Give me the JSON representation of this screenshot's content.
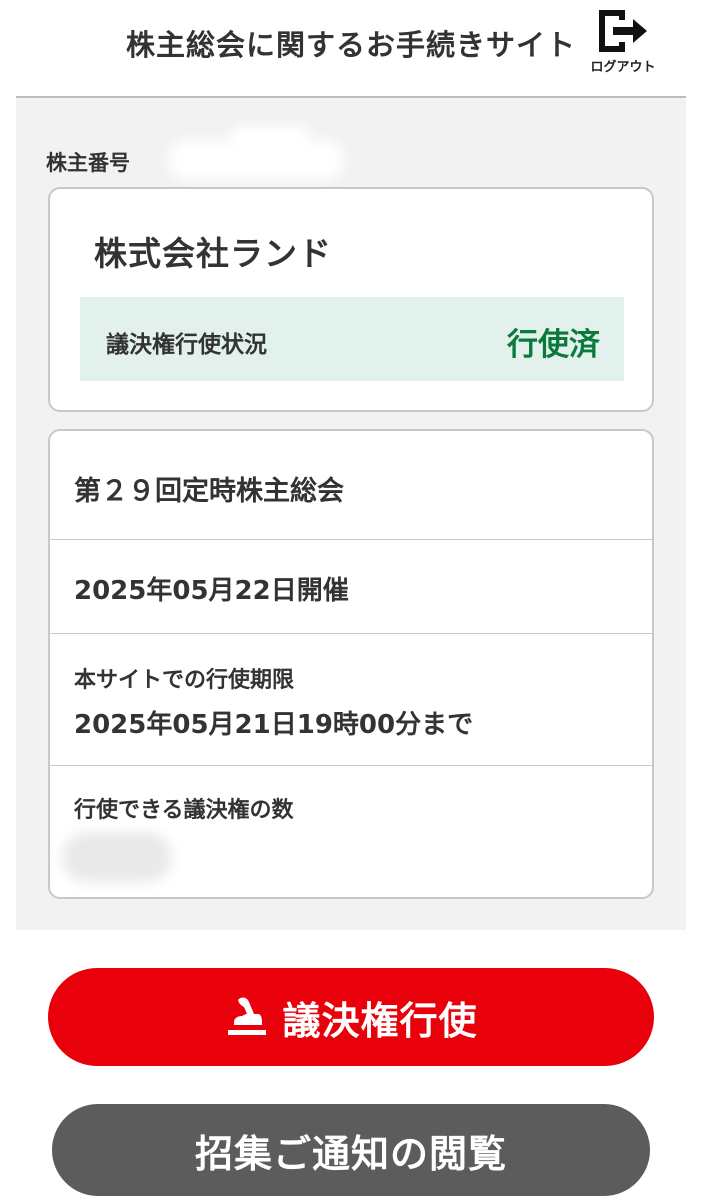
{
  "header": {
    "title": "株主総会に関するお手続きサイト",
    "logout_label": "ログアウト",
    "logout_icon": "logout-icon"
  },
  "shareholder": {
    "number_label": "株主番号"
  },
  "company": {
    "name": "株式会社ランド",
    "status_label": "議決権行使状況",
    "status_value": "行使済",
    "status_color": "#0a7a3c",
    "status_bg": "#e3f1ec"
  },
  "meeting": {
    "title": "第２９回定時株主総会",
    "date": "2025年05月22日開催",
    "deadline_label": "本サイトでの行使期限",
    "deadline_value": "2025年05月21日19時00分まで",
    "votes_label": "行使できる議決権の数"
  },
  "buttons": {
    "vote_label": "議決権行使",
    "vote_icon": "stamp-icon",
    "vote_color": "#e8000b",
    "notice_label": "招集ご通知の閲覧",
    "notice_color": "#5c5c5c"
  }
}
